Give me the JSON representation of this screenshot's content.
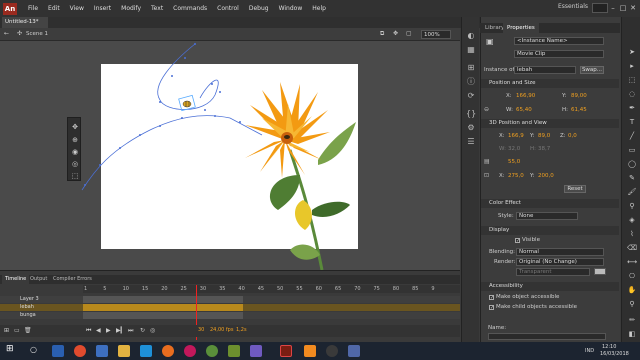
{
  "app": {
    "logo": "An",
    "doc_tab": "Untitled-13*",
    "scene": "Scene 1",
    "zoom": "100%"
  },
  "menu": [
    "File",
    "Edit",
    "View",
    "Insert",
    "Modify",
    "Text",
    "Commands",
    "Control",
    "Debug",
    "Window",
    "Help"
  ],
  "workspace": "Essentials",
  "window_controls": {
    "minimize": "–",
    "maximize": "□",
    "close": "✕"
  },
  "panel_tabs": {
    "library": "Library",
    "properties": "Properties"
  },
  "properties": {
    "instance_name_placeholder": "<Instance Name>",
    "symbol_type": "Movie Clip",
    "instance_of_label": "Instance of:",
    "instance_of": "lebah",
    "swap_label": "Swap...",
    "position_size": {
      "title": "Position and Size",
      "x_label": "X:",
      "x": "166,90",
      "y_label": "Y:",
      "y": "89,00",
      "w_label": "W:",
      "w": "65,40",
      "h_label": "H:",
      "h": "61,45"
    },
    "pos_3d": {
      "title": "3D Position and View",
      "x_label": "X:",
      "x": "166,9",
      "y_label": "Y:",
      "y": "89,0",
      "z_label": "Z:",
      "z": "0,0",
      "w_label": "W:",
      "w": "32,0",
      "h_label": "H:",
      "h": "38,7",
      "persp": "55,0",
      "vx_label": "X:",
      "vx": "275,0",
      "vy_label": "Y:",
      "vy": "200,0",
      "reset": "Reset"
    },
    "color_effect": {
      "title": "Color Effect",
      "style_label": "Style:",
      "style": "None"
    },
    "display": {
      "title": "Display",
      "visible": "Visible",
      "blending_label": "Blending:",
      "blending": "Normal",
      "render_label": "Render:",
      "render": "Original (No Change)",
      "transparent": "Transparent"
    },
    "accessibility": {
      "title": "Accessibility",
      "make_accessible": "Make object accessible",
      "make_child": "Make child objects accessible",
      "name_label": "Name:"
    }
  },
  "timeline": {
    "tabs": [
      "Timeline",
      "Output",
      "Compiler Errors"
    ],
    "ruler": [
      "1",
      "5",
      "10",
      "15",
      "20",
      "25",
      "30",
      "35",
      "40",
      "45",
      "50",
      "55",
      "60",
      "65",
      "70",
      "75",
      "80",
      "85",
      "9"
    ],
    "layers": [
      {
        "name": "Layer 3"
      },
      {
        "name": "lebah"
      },
      {
        "name": "bunga"
      }
    ],
    "fps": "24,00 fps",
    "time": "1,2s",
    "frame": "30"
  },
  "taskbar": {
    "lang": "IND",
    "time": "12:10",
    "date": "16/03/2018"
  },
  "colors": {
    "accent": "#f0a020",
    "panel": "#3c3c3c",
    "playhead": "#ee2222"
  }
}
